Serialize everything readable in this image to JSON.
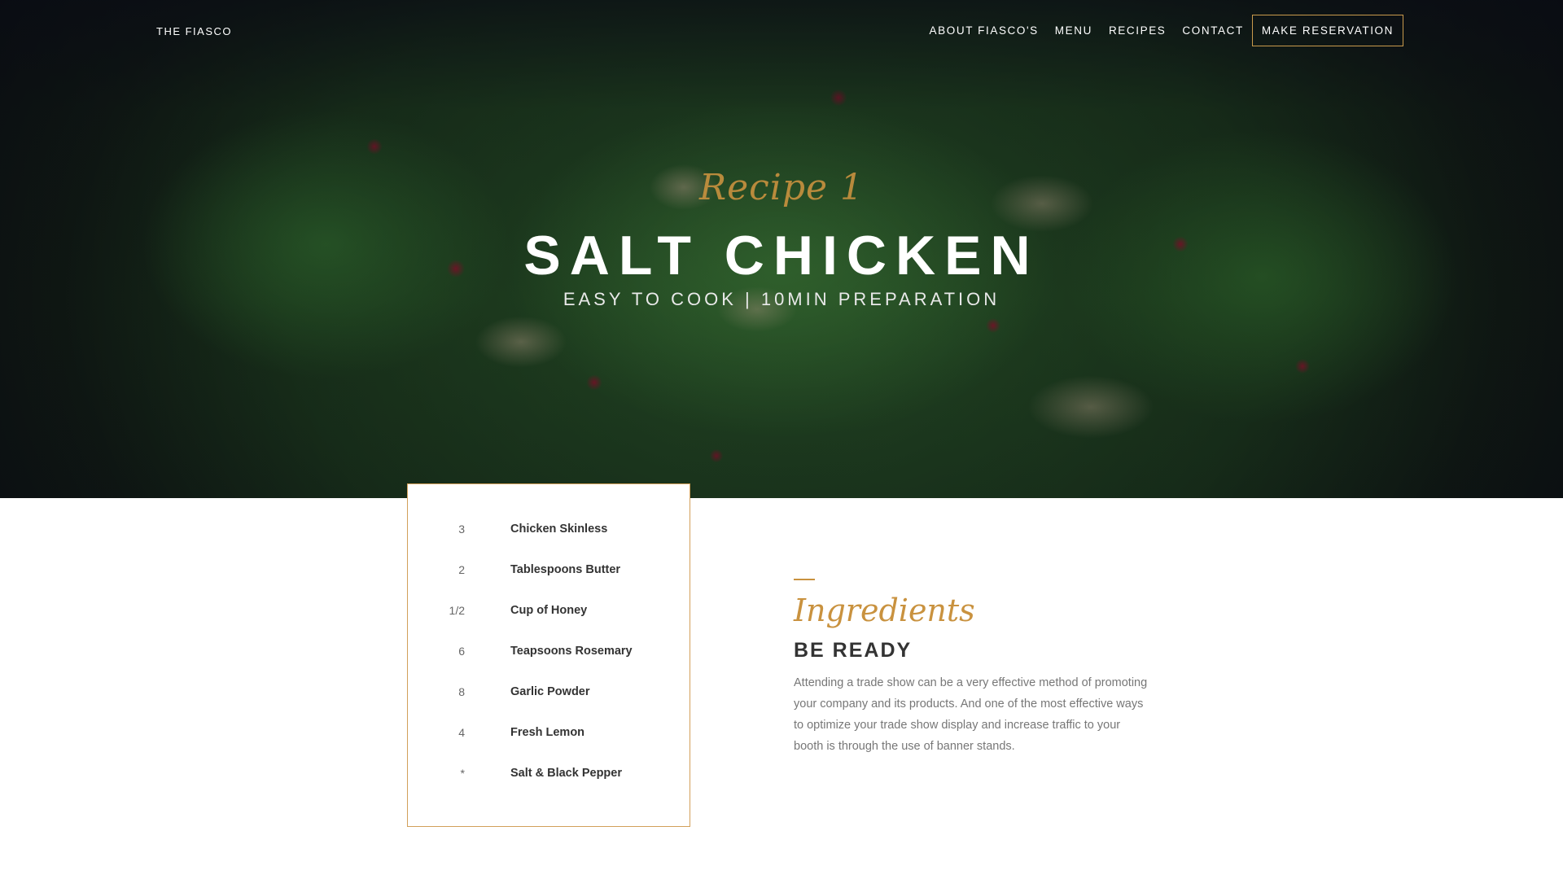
{
  "header": {
    "logo": "THE FIASCO",
    "nav": [
      "ABOUT FIASCO'S",
      "MENU",
      "RECIPES",
      "CONTACT"
    ],
    "cta": "MAKE RESERVATION"
  },
  "hero": {
    "script_label": "Recipe 1",
    "title": "SALT CHICKEN",
    "subtitle": "EASY TO COOK | 10MIN PREPARATION"
  },
  "ingredients": [
    {
      "qty": "3",
      "name": "Chicken Skinless"
    },
    {
      "qty": "2",
      "name": "Tablespoons Butter"
    },
    {
      "qty": "1/2",
      "name": "Cup of Honey"
    },
    {
      "qty": "6",
      "name": "Teapsoons Rosemary"
    },
    {
      "qty": "8",
      "name": "Garlic Powder"
    },
    {
      "qty": "4",
      "name": "Fresh Lemon"
    },
    {
      "qty": "*",
      "name": "Salt & Black Pepper"
    }
  ],
  "section": {
    "script": "Ingredients",
    "title": "BE READY",
    "body": "Attending a trade show can be a very effective method of promoting your company and its products. And one of the most effective ways to optimize your trade show display and increase traffic to your booth is through the use of banner stands."
  },
  "colors": {
    "accent": "#c9923f",
    "card_border": "#d2a05a",
    "hero_overlay": "#0a0c14"
  }
}
